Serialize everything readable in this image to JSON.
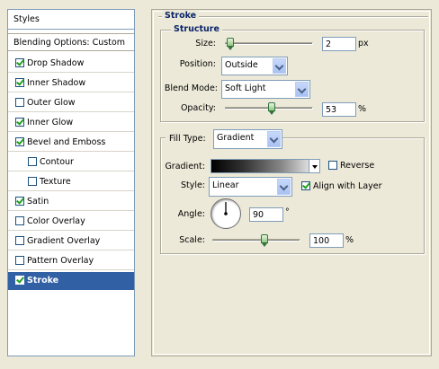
{
  "styles_list": {
    "header": "Styles",
    "blending_options": "Blending Options: Custom",
    "items": [
      {
        "label": "Drop Shadow",
        "checked": true,
        "indent": false
      },
      {
        "label": "Inner Shadow",
        "checked": true,
        "indent": false
      },
      {
        "label": "Outer Glow",
        "checked": false,
        "indent": false
      },
      {
        "label": "Inner Glow",
        "checked": true,
        "indent": false
      },
      {
        "label": "Bevel and Emboss",
        "checked": true,
        "indent": false
      },
      {
        "label": "Contour",
        "checked": false,
        "indent": true
      },
      {
        "label": "Texture",
        "checked": false,
        "indent": true
      },
      {
        "label": "Satin",
        "checked": true,
        "indent": false
      },
      {
        "label": "Color Overlay",
        "checked": false,
        "indent": false
      },
      {
        "label": "Gradient Overlay",
        "checked": false,
        "indent": false
      },
      {
        "label": "Pattern Overlay",
        "checked": false,
        "indent": false
      },
      {
        "label": "Stroke",
        "checked": true,
        "indent": false,
        "selected": true
      }
    ]
  },
  "stroke": {
    "title": "Stroke",
    "structure": {
      "title": "Structure",
      "size_label": "Size:",
      "size_value": "2",
      "size_unit": "px",
      "size_slider": 0.02,
      "position_label": "Position:",
      "position_value": "Outside",
      "blend_mode_label": "Blend Mode:",
      "blend_mode_value": "Soft Light",
      "opacity_label": "Opacity:",
      "opacity_value": "53",
      "opacity_unit": "%",
      "opacity_slider": 0.53
    },
    "fill": {
      "fill_type_label": "Fill Type:",
      "fill_type_value": "Gradient",
      "gradient_label": "Gradient:",
      "reverse_label": "Reverse",
      "reverse_checked": false,
      "style_label": "Style:",
      "style_value": "Linear",
      "align_label": "Align with Layer",
      "align_checked": true,
      "angle_label": "Angle:",
      "angle_value": "90",
      "angle_unit": "°",
      "scale_label": "Scale:",
      "scale_value": "100",
      "scale_unit": "%",
      "scale_slider": 0.6
    }
  },
  "colors": {
    "selection": "#3160a4",
    "legend": "#0a246a",
    "check": "#21a121"
  }
}
